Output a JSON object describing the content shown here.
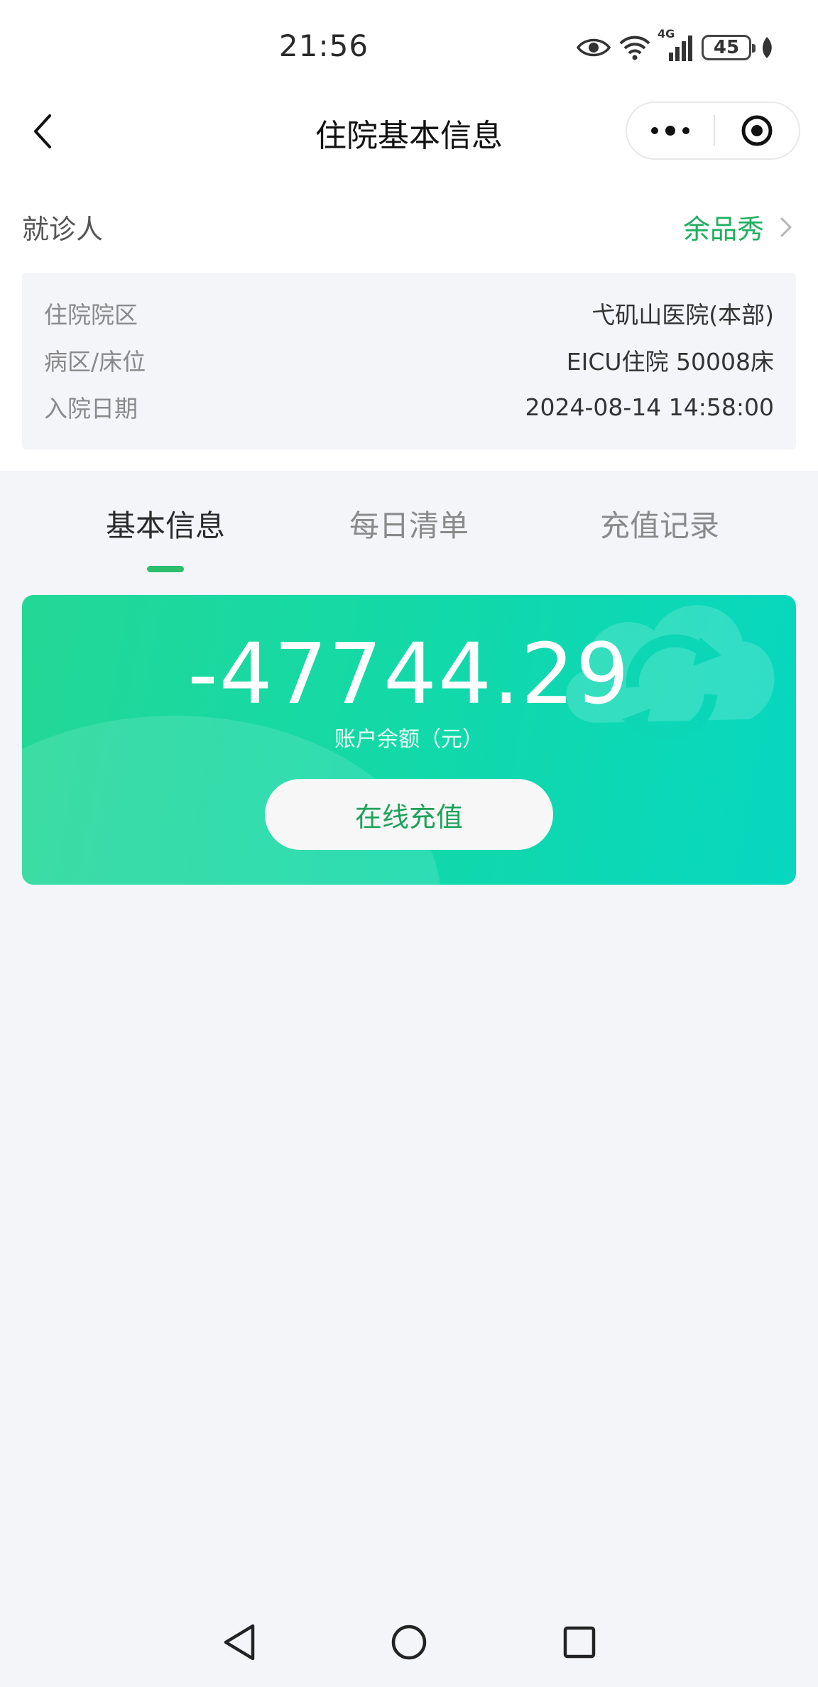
{
  "status_bar": {
    "time": "21:56",
    "network": "4G",
    "battery": "45",
    "icons": [
      "eye-icon",
      "wifi-icon",
      "signal-icon",
      "battery-icon",
      "leaf-icon"
    ]
  },
  "nav": {
    "title": "住院基本信息",
    "back_icon": "chevron-left-icon",
    "more_icon": "more-dots-icon",
    "close_icon": "target-close-icon"
  },
  "patient": {
    "label": "就诊人",
    "name": "余品秀"
  },
  "info": {
    "rows": [
      {
        "label": "住院院区",
        "value": "弋矶山医院(本部)"
      },
      {
        "label": "病区/床位",
        "value": "EICU住院 50008床"
      },
      {
        "label": "入院日期",
        "value": "2024-08-14 14:58:00"
      }
    ]
  },
  "tabs": [
    {
      "label": "基本信息",
      "active": true
    },
    {
      "label": "每日清单",
      "active": false
    },
    {
      "label": "充值记录",
      "active": false
    }
  ],
  "balance": {
    "amount": "-47744.29",
    "label": "账户余额（元）",
    "button": "在线充值"
  },
  "bottom_nav": [
    "back-triangle-icon",
    "home-circle-icon",
    "recents-square-icon"
  ],
  "colors": {
    "accent_green": "#1fae5f",
    "card_gradient_start": "#23d896",
    "card_gradient_end": "#07d7c0",
    "page_background": "#f4f5f9"
  }
}
